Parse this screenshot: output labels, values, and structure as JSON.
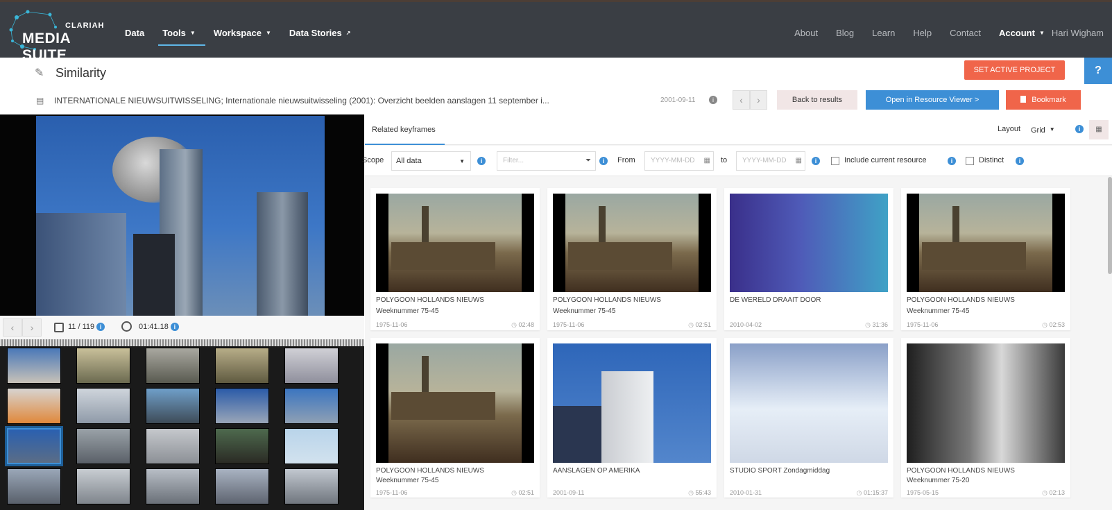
{
  "navbar": {
    "logo_small": "CLARIAH",
    "logo_big": "MEDIA SUITE",
    "left": [
      {
        "label": "Data"
      },
      {
        "label": "Tools",
        "caret": "▼"
      },
      {
        "label": "Workspace",
        "caret": "▼"
      },
      {
        "label": "Data Stories",
        "caret": "↗"
      }
    ],
    "right": [
      "About",
      "Blog",
      "Learn",
      "Help",
      "Contact"
    ],
    "account": "Account",
    "account_caret": "▼",
    "user": "Hari Wigham"
  },
  "header": {
    "title": "Similarity",
    "set_active_project": "SET ACTIVE PROJECT",
    "help": "?"
  },
  "resource": {
    "title": "INTERNATIONALE NIEUWSUITWISSELING; Internationale nieuwsuitwisseling (2001): Overzicht beelden aanslagen 11 september i...",
    "date": "2001-09-11",
    "back": "Back to results",
    "open": "Open in Resource Viewer  >",
    "bookmark": "Bookmark"
  },
  "player": {
    "frame_counter": "11 / 119",
    "timecode": "01:41.18"
  },
  "panel": {
    "tab": "Related keyframes",
    "layout_label": "Layout",
    "layout_value": "Grid",
    "scope_label": "Scope",
    "scope_value": "All data",
    "filter_placeholder": "Filter...",
    "from_label": "From",
    "to_label": "to",
    "date_placeholder": "YYYY-MM-DD",
    "include_label": "Include current resource",
    "distinct_label": "Distinct"
  },
  "cards": [
    {
      "title": "POLYGOON HOLLANDS NIEUWS",
      "subtitle": "Weeknummer 75-45",
      "date": "1975-11-06",
      "duration": "02:48",
      "scene": "palace"
    },
    {
      "title": "POLYGOON HOLLANDS NIEUWS",
      "subtitle": "Weeknummer 75-45",
      "date": "1975-11-06",
      "duration": "02:51",
      "scene": "palace"
    },
    {
      "title": "DE WERELD DRAAIT DOOR",
      "subtitle": "",
      "date": "2010-04-02",
      "duration": "31:36",
      "scene": "studio"
    },
    {
      "title": "POLYGOON HOLLANDS NIEUWS",
      "subtitle": "Weeknummer 75-45",
      "date": "1975-11-06",
      "duration": "02:53",
      "scene": "palace"
    },
    {
      "title": "POLYGOON HOLLANDS NIEUWS",
      "subtitle": "Weeknummer 75-45",
      "date": "1975-11-06",
      "duration": "02:51",
      "scene": "palace"
    },
    {
      "title": "AANSLAGEN OP AMERIKA",
      "subtitle": "",
      "date": "2001-09-11",
      "duration": "55:43",
      "scene": "wtc"
    },
    {
      "title": "STUDIO SPORT Zondagmiddag",
      "subtitle": "",
      "date": "2010-01-31",
      "duration": "01:15:37",
      "scene": "cycle"
    },
    {
      "title": "POLYGOON HOLLANDS NIEUWS",
      "subtitle": "Weeknummer 75-20",
      "date": "1975-05-15",
      "duration": "02:13",
      "scene": "bw"
    }
  ]
}
